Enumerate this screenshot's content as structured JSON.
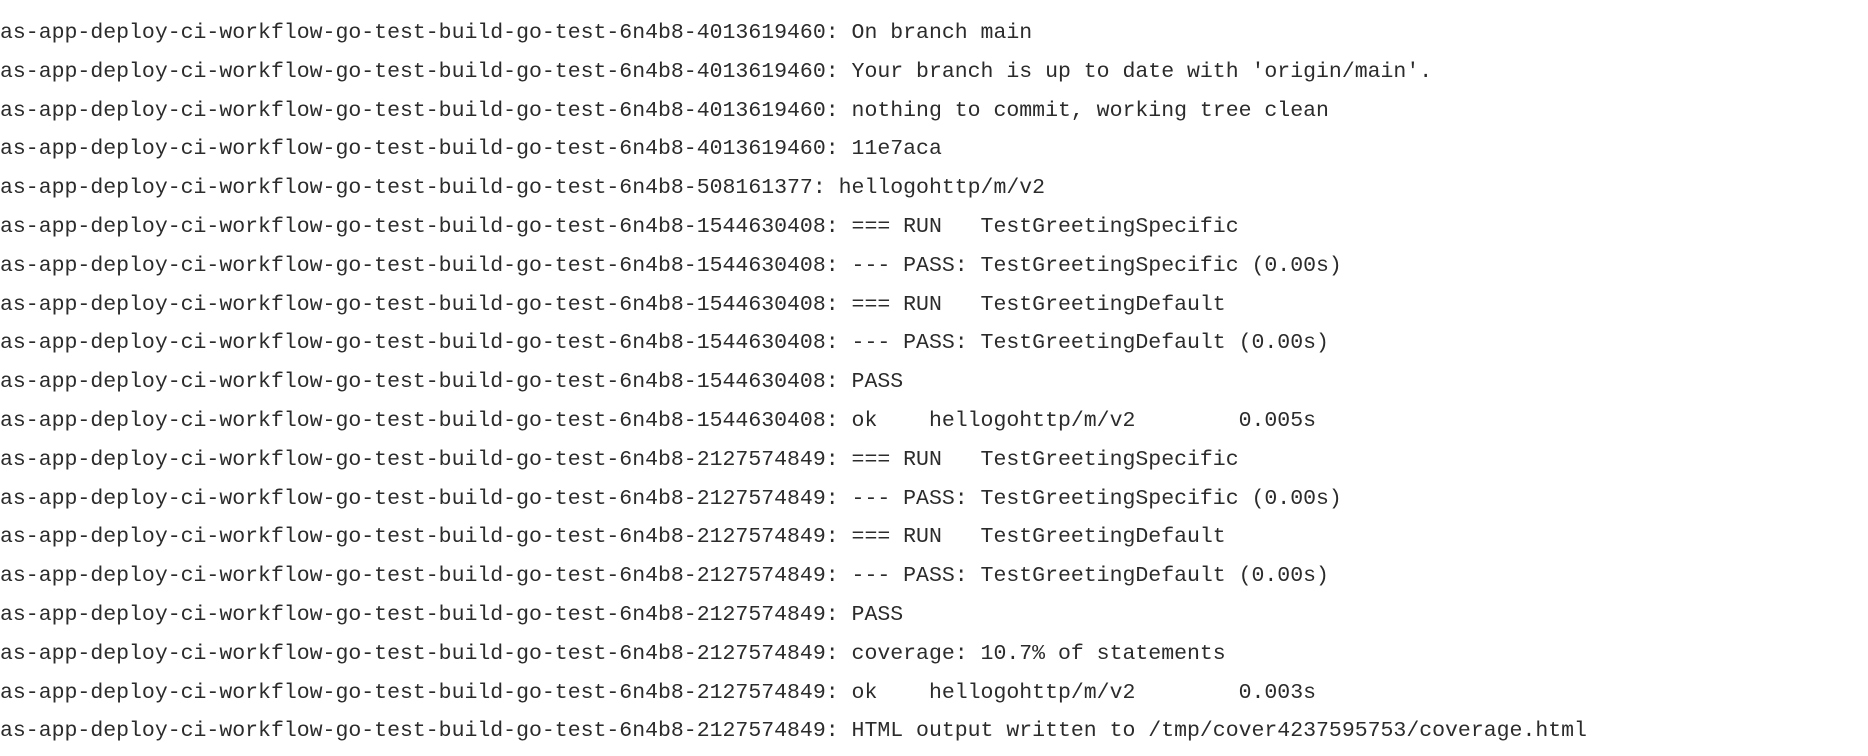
{
  "log": {
    "lines": [
      "as-app-deploy-ci-workflow-go-test-build-go-test-6n4b8-4013619460: On branch main",
      "as-app-deploy-ci-workflow-go-test-build-go-test-6n4b8-4013619460: Your branch is up to date with 'origin/main'.",
      "as-app-deploy-ci-workflow-go-test-build-go-test-6n4b8-4013619460: nothing to commit, working tree clean",
      "as-app-deploy-ci-workflow-go-test-build-go-test-6n4b8-4013619460: 11e7aca",
      "as-app-deploy-ci-workflow-go-test-build-go-test-6n4b8-508161377: hellogohttp/m/v2",
      "as-app-deploy-ci-workflow-go-test-build-go-test-6n4b8-1544630408: === RUN   TestGreetingSpecific",
      "as-app-deploy-ci-workflow-go-test-build-go-test-6n4b8-1544630408: --- PASS: TestGreetingSpecific (0.00s)",
      "as-app-deploy-ci-workflow-go-test-build-go-test-6n4b8-1544630408: === RUN   TestGreetingDefault",
      "as-app-deploy-ci-workflow-go-test-build-go-test-6n4b8-1544630408: --- PASS: TestGreetingDefault (0.00s)",
      "as-app-deploy-ci-workflow-go-test-build-go-test-6n4b8-1544630408: PASS",
      "as-app-deploy-ci-workflow-go-test-build-go-test-6n4b8-1544630408: ok    hellogohttp/m/v2        0.005s",
      "as-app-deploy-ci-workflow-go-test-build-go-test-6n4b8-2127574849: === RUN   TestGreetingSpecific",
      "as-app-deploy-ci-workflow-go-test-build-go-test-6n4b8-2127574849: --- PASS: TestGreetingSpecific (0.00s)",
      "as-app-deploy-ci-workflow-go-test-build-go-test-6n4b8-2127574849: === RUN   TestGreetingDefault",
      "as-app-deploy-ci-workflow-go-test-build-go-test-6n4b8-2127574849: --- PASS: TestGreetingDefault (0.00s)",
      "as-app-deploy-ci-workflow-go-test-build-go-test-6n4b8-2127574849: PASS",
      "as-app-deploy-ci-workflow-go-test-build-go-test-6n4b8-2127574849: coverage: 10.7% of statements",
      "as-app-deploy-ci-workflow-go-test-build-go-test-6n4b8-2127574849: ok    hellogohttp/m/v2        0.003s",
      "as-app-deploy-ci-workflow-go-test-build-go-test-6n4b8-2127574849: HTML output written to /tmp/cover4237595753/coverage.html"
    ]
  },
  "colors": {
    "background": "#ffffff",
    "text": "#2b2b2b"
  }
}
